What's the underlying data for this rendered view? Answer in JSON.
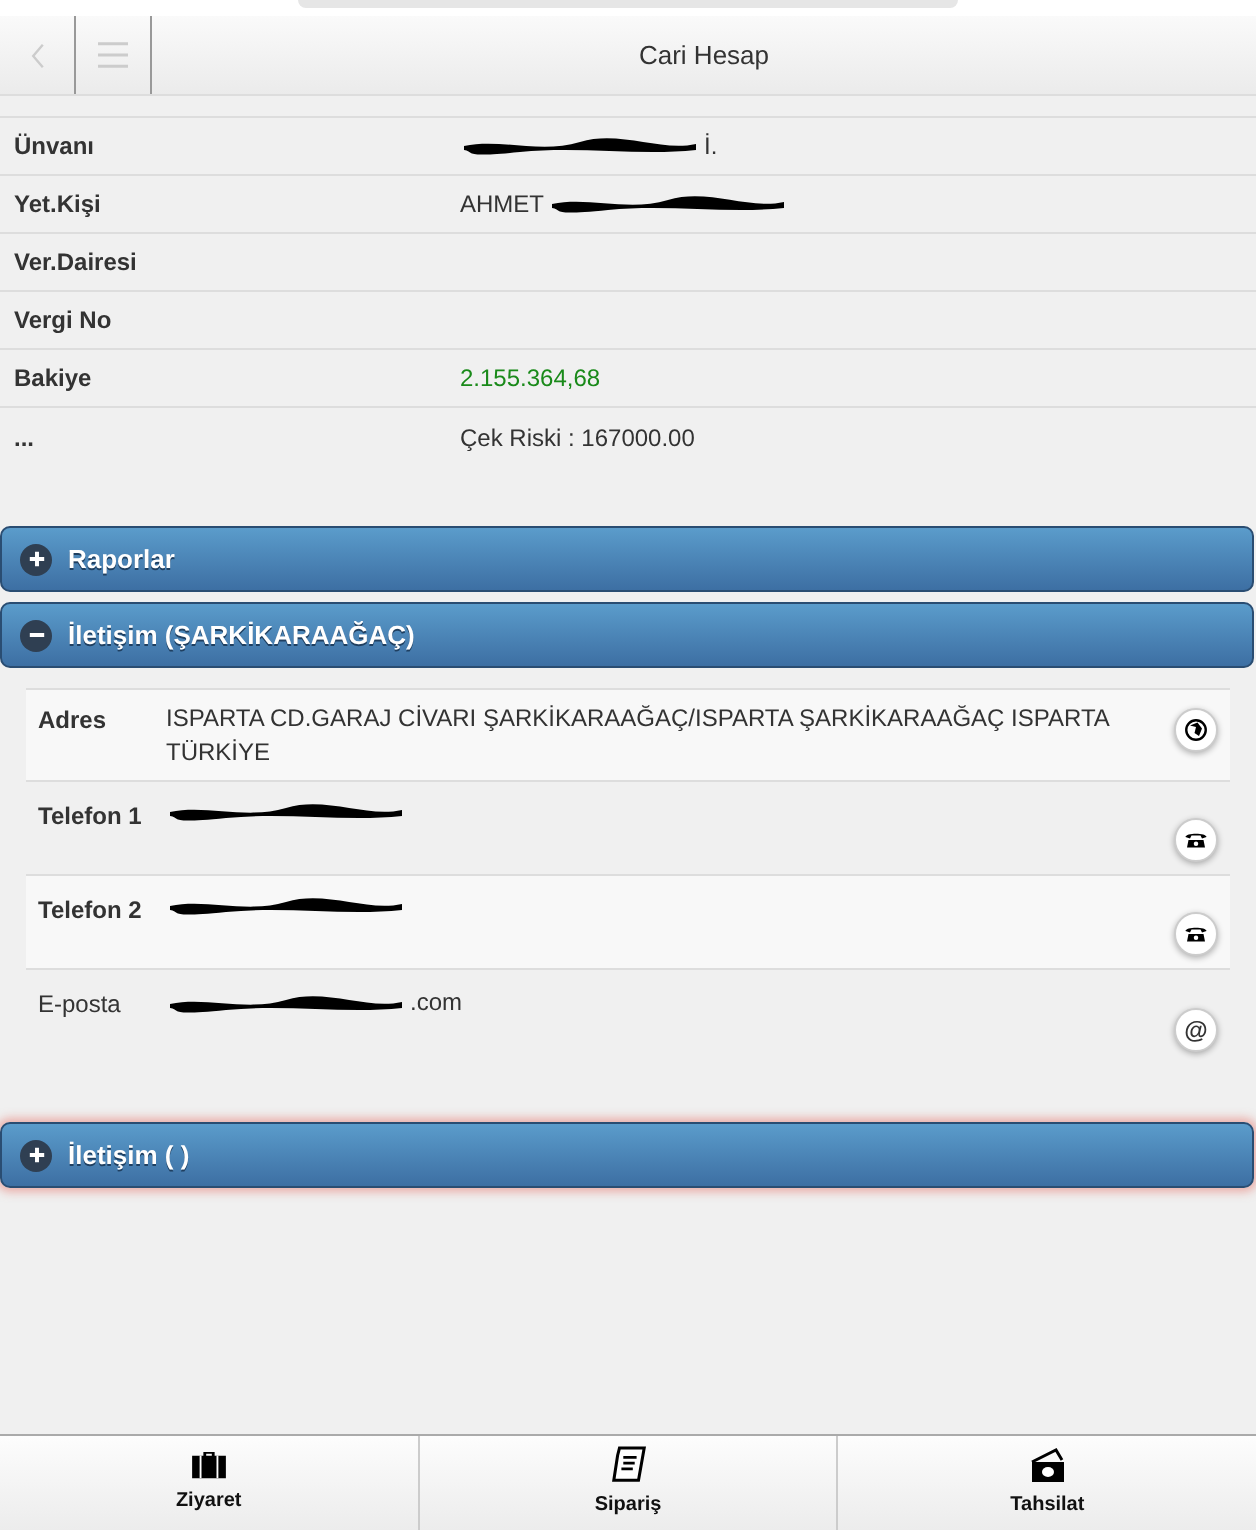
{
  "header": {
    "title": "Cari Hesap"
  },
  "details": [
    {
      "label": "Ünvanı",
      "after": "İ.",
      "redacted": true,
      "kind": "plain"
    },
    {
      "label": "Yet.Kişi",
      "before": "AHMET",
      "redacted": true,
      "kind": "plain"
    },
    {
      "label": "Ver.Dairesi"
    },
    {
      "label": "Vergi No"
    },
    {
      "label": "Bakiye",
      "value": "2.155.364,68",
      "kind": "amount"
    },
    {
      "label": "...",
      "value": "Çek Riski : 167000.00",
      "kind": "plain"
    }
  ],
  "sections": [
    {
      "title": "Raporlar",
      "expanded": false,
      "highlighted": false
    },
    {
      "title": "İletişim (ŞARKİKARAAĞAÇ)",
      "expanded": true,
      "highlighted": false,
      "rows": [
        {
          "label": "Adres",
          "value": "ISPARTA CD.GARAJ CİVARI ŞARKİKARAAĞAÇ/ISPARTA ŞARKİKARAAĞAÇ ISPARTA TÜRKİYE",
          "kind": "map"
        },
        {
          "label": "Telefon 1",
          "kind": "phone",
          "redacted": true
        },
        {
          "label": "Telefon 2",
          "kind": "phone",
          "redacted": true
        },
        {
          "label": "E-posta",
          "after": ".com",
          "kind": "email",
          "redacted": true,
          "icon": "@"
        }
      ]
    },
    {
      "title": "İletişim ( )",
      "expanded": false,
      "highlighted": true
    }
  ],
  "footer": [
    {
      "label": "Ziyaret",
      "kind": "briefcase"
    },
    {
      "label": "Sipariş",
      "kind": "order"
    },
    {
      "label": "Tahsilat",
      "kind": "money"
    }
  ]
}
